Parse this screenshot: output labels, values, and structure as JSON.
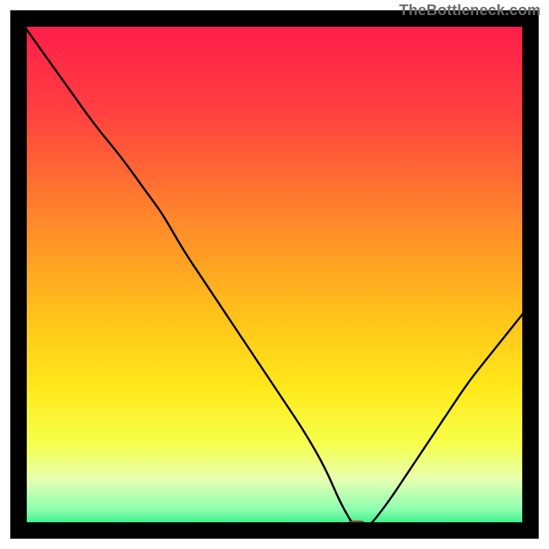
{
  "watermark": "TheBottleneck.com",
  "chart_data": {
    "type": "line",
    "title": "",
    "xlabel": "",
    "ylabel": "",
    "xlim": [
      0,
      100
    ],
    "ylim": [
      0,
      100
    ],
    "background_gradient": {
      "stops": [
        {
          "pos": 0.0,
          "color": "#ff1a4b"
        },
        {
          "pos": 0.18,
          "color": "#ff4040"
        },
        {
          "pos": 0.4,
          "color": "#ff8a2a"
        },
        {
          "pos": 0.58,
          "color": "#ffc21a"
        },
        {
          "pos": 0.72,
          "color": "#ffe81a"
        },
        {
          "pos": 0.83,
          "color": "#f7ff4a"
        },
        {
          "pos": 0.9,
          "color": "#e8ffb0"
        },
        {
          "pos": 0.96,
          "color": "#8dffb0"
        },
        {
          "pos": 1.0,
          "color": "#17e879"
        }
      ]
    },
    "frame_color": "#000000",
    "curve_color": "#000000",
    "marker": {
      "x": 66,
      "y": 0,
      "color": "#e36f6f",
      "outline": "#6a1f1f"
    },
    "series": [
      {
        "name": "bottleneck-curve",
        "x": [
          0,
          5,
          10,
          15,
          20,
          25,
          28,
          32,
          36,
          40,
          44,
          48,
          52,
          56,
          60,
          63,
          66,
          68,
          72,
          76,
          80,
          84,
          88,
          92,
          96,
          100
        ],
        "y": [
          100,
          93,
          86,
          79,
          73,
          66,
          62,
          55,
          49,
          43,
          37,
          31,
          25,
          19,
          12,
          5,
          0,
          0,
          5,
          11,
          17,
          23,
          29,
          34,
          39,
          44
        ]
      }
    ]
  }
}
